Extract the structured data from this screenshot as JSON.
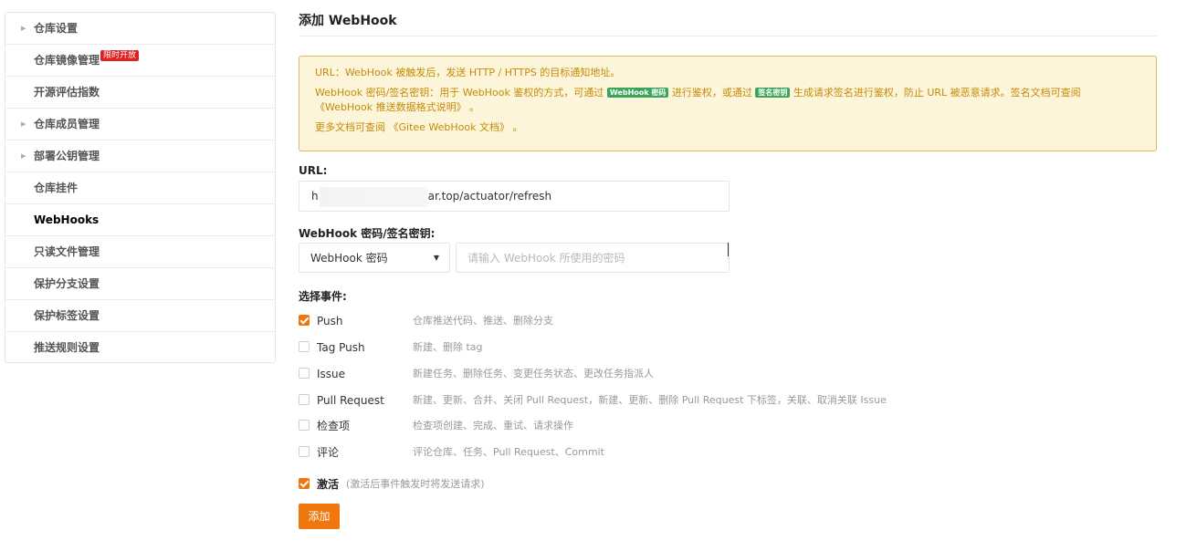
{
  "sidebar": {
    "items": [
      {
        "label": "仓库设置",
        "has_caret": true
      },
      {
        "label": "仓库镜像管理",
        "badge": "限时开放"
      },
      {
        "label": "开源评估指数"
      },
      {
        "label": "仓库成员管理",
        "has_caret": true
      },
      {
        "label": "部署公钥管理",
        "has_caret": true
      },
      {
        "label": "仓库挂件"
      },
      {
        "label": "WebHooks",
        "active": true
      },
      {
        "label": "只读文件管理"
      },
      {
        "label": "保护分支设置"
      },
      {
        "label": "保护标签设置"
      },
      {
        "label": "推送规则设置"
      }
    ]
  },
  "main": {
    "title": "添加 WebHook",
    "notice": {
      "line1": "URL：WebHook 被触发后，发送 HTTP / HTTPS 的目标通知地址。",
      "line2_a": "WebHook 密码/签名密钥：用于 WebHook 鉴权的方式，可通过",
      "tag_password": "WebHook 密码",
      "line2_b": "进行鉴权，或通过",
      "tag_sign": "签名密钥",
      "line2_c": "生成请求签名进行鉴权，防止 URL 被恶意请求。签名文档可查阅",
      "line2_link": "《WebHook 推送数据格式说明》",
      "line2_end": "。",
      "line3_a": "更多文档可查阅",
      "line3_link": "《Gitee WebHook 文档》",
      "line3_end": "。"
    },
    "url_label": "URL:",
    "url_value_prefix": "h",
    "url_value_suffix": "ar.top/actuator/refresh",
    "secret_label": "WebHook 密码/签名密钥:",
    "secret_type": "WebHook 密码",
    "secret_placeholder": "请输入 WebHook 所使用的密码",
    "events_label": "选择事件:",
    "events": [
      {
        "name": "Push",
        "desc": "仓库推送代码、推送、删除分支",
        "checked": true
      },
      {
        "name": "Tag Push",
        "desc": "新建、删除 tag",
        "checked": false
      },
      {
        "name": "Issue",
        "desc": "新建任务、删除任务、变更任务状态、更改任务指派人",
        "checked": false
      },
      {
        "name": "Pull Request",
        "desc": "新建、更新、合并、关闭 Pull Request，新建、更新、删除 Pull Request 下标签，关联、取消关联 Issue",
        "checked": false
      },
      {
        "name": "检查项",
        "desc": "检查项创建、完成、重试、请求操作",
        "checked": false
      },
      {
        "name": "评论",
        "desc": "评论仓库、任务、Pull Request、Commit",
        "checked": false
      }
    ],
    "activate_label": "激活",
    "activate_hint": "(激活后事件触发时将发送请求)",
    "activate_checked": true,
    "submit_label": "添加"
  },
  "colors": {
    "accent": "#f0760e",
    "notice_bg": "#fcf5da",
    "notice_border": "#e2b85f",
    "notice_text": "#c48a08",
    "tag_green": "#3aa55a",
    "badge_red": "#e02020"
  },
  "icons": {
    "caret": "caret-right-icon",
    "dropdown": "caret-down-icon",
    "check": "check-icon"
  }
}
